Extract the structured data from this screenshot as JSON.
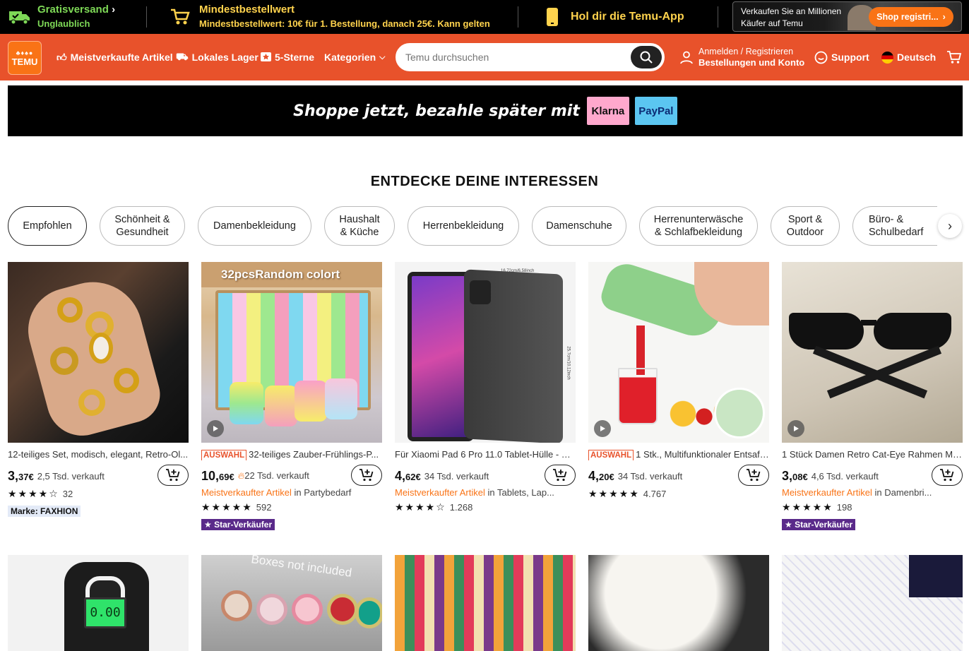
{
  "topbar": {
    "shipping_title": "Gratisversand",
    "shipping_sub": "Unglaublich",
    "minorder_title": "Mindestbestellwert",
    "minorder_sub": "Mindestbestellwert: 10€ für 1. Bestellung, danach 25€. Kann gelten",
    "app_label": "Hol dir die Temu-App",
    "seller_line1": "Verkaufen Sie an Millionen",
    "seller_line2": "Käufer auf Temu",
    "seller_button": "Shop registri..."
  },
  "nav": {
    "logo_text": "TEMU",
    "bestsellers": "Meistverkaufte Artikel",
    "local_warehouse": "Lokales Lager",
    "five_stars": "5-Sterne",
    "categories": "Kategorien",
    "search_placeholder": "Temu durchsuchen",
    "signin_line1": "Anmelden / Registrieren",
    "signin_line2": "Bestellungen und Konto",
    "support": "Support",
    "language": "Deutsch"
  },
  "banner": {
    "text": "Shoppe jetzt, bezahle später mit",
    "klarna": "Klarna",
    "paypal": "PayPal"
  },
  "section_title": "ENTDECKE DEINE INTERESSEN",
  "categories": [
    {
      "line1": "Empfohlen",
      "line2": ""
    },
    {
      "line1": "Schönheit &",
      "line2": "Gesundheit"
    },
    {
      "line1": "Damenbekleidung",
      "line2": ""
    },
    {
      "line1": "Haushalt",
      "line2": "& Küche"
    },
    {
      "line1": "Herrenbekleidung",
      "line2": ""
    },
    {
      "line1": "Damenschuhe",
      "line2": ""
    },
    {
      "line1": "Herrenunterwäsche",
      "line2": "& Schlafbekleidung"
    },
    {
      "line1": "Sport &",
      "line2": "Outdoor"
    },
    {
      "line1": "Büro- &",
      "line2": "Schulbedarf"
    }
  ],
  "products": [
    {
      "title": "12-teiliges Set, modisch, elegant, Retro-Ol...",
      "auswahl": "",
      "price_int": "3,",
      "price_dec": "37€",
      "sold": "2,5 Tsd. verkauft",
      "best_label": "",
      "best_in": "",
      "stars": "★★★★☆",
      "reviews": "32",
      "badge": "Marke: FAXHION"
    },
    {
      "title": "32-teiliges Zauber-Frühlings-P...",
      "auswahl": "AUSWAHL",
      "price_int": "10,",
      "price_dec": "69€",
      "sold": "22 Tsd. verkauft",
      "best_label": "Meistverkaufter Artikel",
      "best_in": " in Partybedarf",
      "stars": "★★★★★",
      "reviews": "592",
      "badge": "Star-Verkäufer"
    },
    {
      "title": "Für Xiaomi Pad 6 Pro 11.0 Tablet-Hülle - M...",
      "auswahl": "",
      "price_int": "4,",
      "price_dec": "62€",
      "sold": "34 Tsd. verkauft",
      "best_label": "Meistverkaufter Artikel",
      "best_in": " in Tablets, Lap...",
      "stars": "★★★★☆",
      "reviews": "1.268",
      "badge": ""
    },
    {
      "title": "1 Stk., Multifunktionaler Entsaft...",
      "auswahl": "AUSWAHL",
      "price_int": "4,",
      "price_dec": "20€",
      "sold": "34 Tsd. verkauft",
      "best_label": "",
      "best_in": "",
      "stars": "★★★★★",
      "reviews": "4.767",
      "badge": ""
    },
    {
      "title": "1 Stück Damen Retro Cat-Eye Rahmen Mo...",
      "auswahl": "",
      "price_int": "3,",
      "price_dec": "08€",
      "sold": "4,6 Tsd. verkauft",
      "best_label": "Meistverkaufter Artikel",
      "best_in": " in Damenbri...",
      "stars": "★★★★★",
      "reviews": "198",
      "badge": "Star-Verkäufer"
    }
  ],
  "image_texts": {
    "slinky": "32pcsRandom colort",
    "watches": "Boxes not included",
    "tablet_w": "16.72cm/6.58inch",
    "tablet_h": "25.7cm/10.12inch",
    "scale": "0.00"
  },
  "colors": {
    "brand_orange": "#e8522b",
    "accent_orange": "#f97316",
    "topbar_bg": "#000000",
    "green": "#7ed957",
    "yellow": "#ffd34d"
  }
}
